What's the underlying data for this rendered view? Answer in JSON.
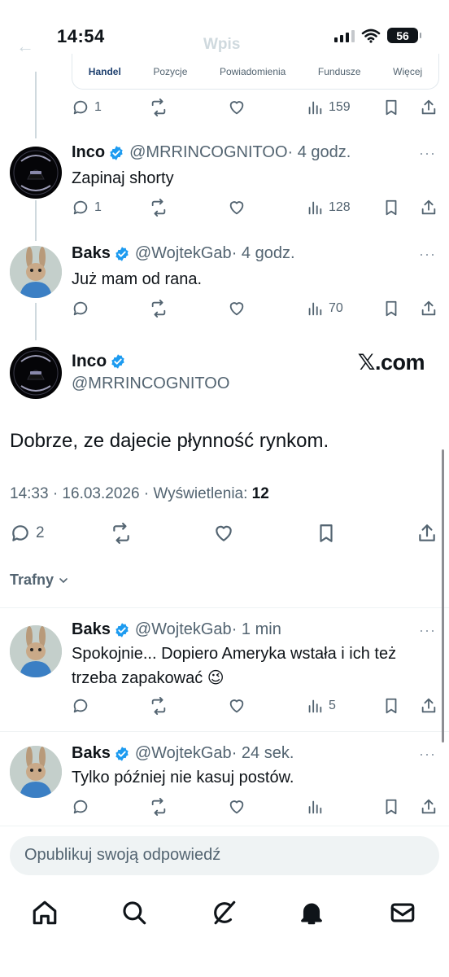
{
  "status_bar": {
    "time": "14:54",
    "battery": "56"
  },
  "header": {
    "back_label": "←",
    "title": "Wpis"
  },
  "embedded_tabs": [
    {
      "label": "Handel",
      "active": true
    },
    {
      "label": "Pozycje",
      "active": false
    },
    {
      "label": "Powiadomienia",
      "active": false
    },
    {
      "label": "Fundusze",
      "active": false
    },
    {
      "label": "Więcej",
      "active": false
    }
  ],
  "parent_actions": {
    "replies": "1",
    "views": "159"
  },
  "tweets": [
    {
      "name": "Inco",
      "handle": "@MRRINCOGNITOO",
      "time": "· 4 godz.",
      "text": "Zapinaj shorty",
      "replies": "1",
      "views": "128"
    },
    {
      "name": "Baks",
      "handle": "@WojtekGab",
      "time": "· 4 godz.",
      "text": "Już mam od rana.",
      "replies": "",
      "views": "70"
    }
  ],
  "main_tweet": {
    "name": "Inco",
    "handle": "@MRRINCOGNITOO",
    "watermark": "𝕏.com",
    "text": "Dobrze, ze dajecie płynność rynkom.",
    "timestamp": "14:33 · 16.03.2026 · Wyświetlenia: ",
    "views": "12",
    "replies": "2"
  },
  "sort_label": "Trafny",
  "replies": [
    {
      "name": "Baks",
      "handle": "@WojtekGab",
      "time": "· 1 min",
      "text": "Spokojnie... Dopiero Ameryka wstała i ich też trzeba zapakować 😉",
      "views": "5"
    },
    {
      "name": "Baks",
      "handle": "@WojtekGab",
      "time": "· 24 sek.",
      "text": "Tylko później nie kasuj postów.",
      "views": ""
    }
  ],
  "composer": {
    "placeholder": "Opublikuj swoją odpowiedź"
  },
  "more_label": "···",
  "colors": {
    "verified": "#1d9bf0",
    "muted": "#536471",
    "text": "#0f1419"
  },
  "icons": [
    "reply-icon",
    "repost-icon",
    "like-icon",
    "views-icon",
    "bookmark-icon",
    "share-icon",
    "home-icon",
    "search-icon",
    "grok-icon",
    "notifications-icon",
    "messages-icon"
  ]
}
